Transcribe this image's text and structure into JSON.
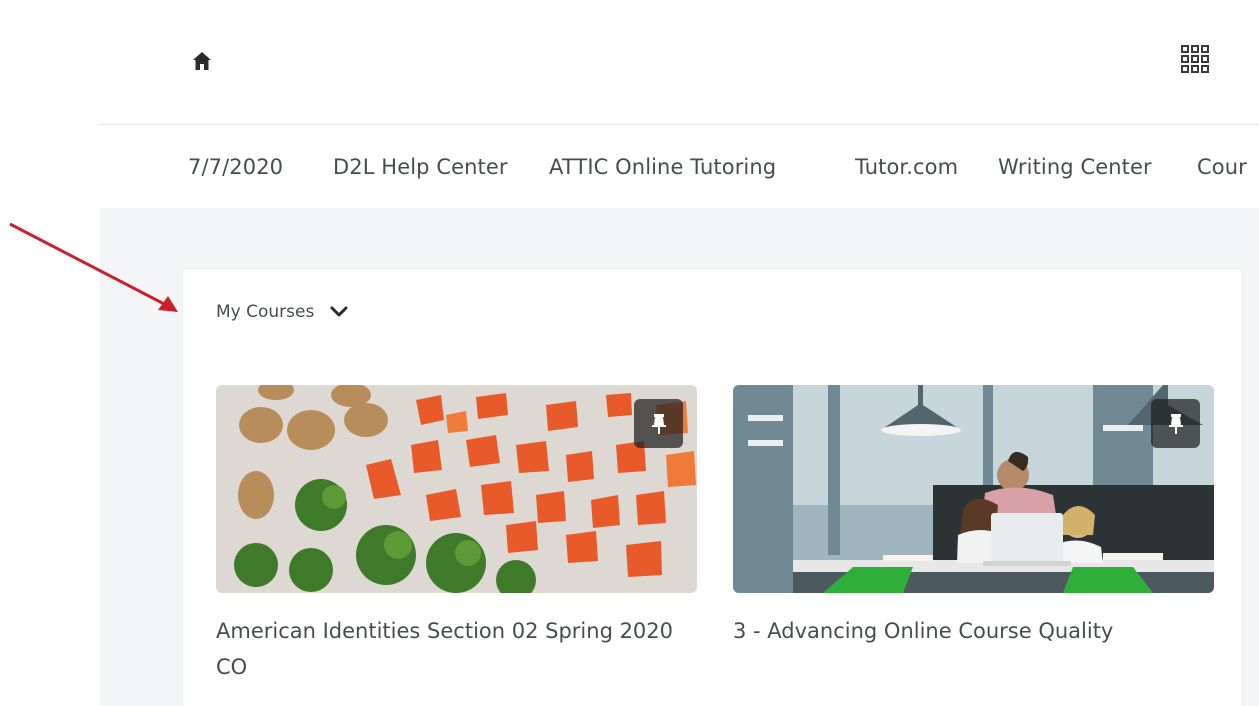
{
  "topbar": {
    "home_icon": "home-icon",
    "apps_icon": "grid-icon"
  },
  "nav": {
    "links": [
      "7/7/2020",
      "D2L Help Center",
      "ATTIC Online Tutoring",
      "Tutor.com",
      "Writing Center",
      "Cour"
    ]
  },
  "widget": {
    "title": "My Courses",
    "toggle_icon": "chevron-down-icon"
  },
  "courses": [
    {
      "title": "American Identities Section 02 Spring 2020 CO",
      "pin_icon": "pin-icon"
    },
    {
      "title": "3 - Advancing Online Course Quality",
      "pin_icon": "pin-icon"
    }
  ],
  "colors": {
    "annotation_arrow": "#c8202c",
    "page_background": "#f4f5f7",
    "text": "#494c4e"
  }
}
